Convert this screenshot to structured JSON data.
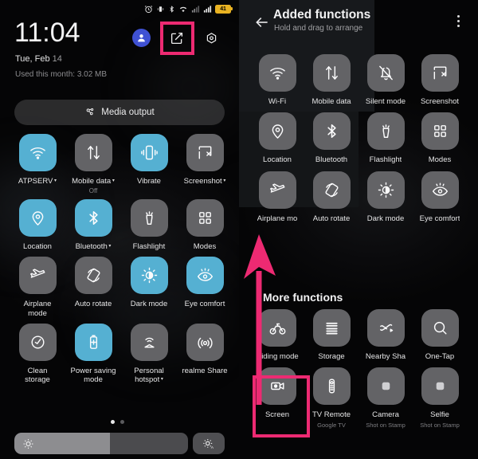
{
  "statusbar": {
    "icons": [
      "alarm-icon",
      "vibrate-icon",
      "bluetooth-icon",
      "wifi-icon",
      "signal-1-icon",
      "signal-2-icon"
    ],
    "battery_level": "41"
  },
  "shade": {
    "time": "11:04",
    "date_day": "Tue, Feb ",
    "date_num": "14",
    "data_usage": "Used this month: 3.02 MB",
    "media_output_label": "Media output",
    "avatar": "user-avatar",
    "edit_icon": "edit-icon",
    "settings_icon": "gear-icon",
    "page_dots": [
      "active",
      "inactive"
    ],
    "brightness_percent": 55,
    "auto_brightness_label": "auto-brightness"
  },
  "quick_tiles": [
    {
      "label": "ATPSERV",
      "caret": true,
      "sub": "",
      "on": true,
      "icon": "wifi-icon"
    },
    {
      "label": "Mobile data",
      "caret": true,
      "sub": "Off",
      "on": false,
      "icon": "mobile-data-icon"
    },
    {
      "label": "Vibrate",
      "caret": false,
      "sub": "",
      "on": true,
      "icon": "vibrate-icon"
    },
    {
      "label": "Screenshot",
      "caret": true,
      "sub": "",
      "on": false,
      "icon": "screenshot-icon"
    },
    {
      "label": "Location",
      "caret": false,
      "sub": "",
      "on": true,
      "icon": "location-icon"
    },
    {
      "label": "Bluetooth",
      "caret": true,
      "sub": "",
      "on": true,
      "icon": "bluetooth-icon"
    },
    {
      "label": "Flashlight",
      "caret": false,
      "sub": "",
      "on": false,
      "icon": "flashlight-icon"
    },
    {
      "label": "Modes",
      "caret": false,
      "sub": "",
      "on": false,
      "icon": "modes-icon"
    },
    {
      "label": "Airplane\nmode",
      "caret": false,
      "sub": "",
      "on": false,
      "icon": "airplane-icon"
    },
    {
      "label": "Auto rotate",
      "caret": false,
      "sub": "",
      "on": false,
      "icon": "auto-rotate-icon"
    },
    {
      "label": "Dark mode",
      "caret": false,
      "sub": "",
      "on": true,
      "icon": "dark-mode-icon"
    },
    {
      "label": "Eye comfort",
      "caret": false,
      "sub": "",
      "on": true,
      "icon": "eye-comfort-icon"
    },
    {
      "label": "Clean\nstorage",
      "caret": false,
      "sub": "",
      "on": false,
      "icon": "clean-storage-icon"
    },
    {
      "label": "Power saving\nmode",
      "caret": false,
      "sub": "",
      "on": true,
      "icon": "power-saving-icon"
    },
    {
      "label": "Personal\nhotspot",
      "caret": true,
      "sub": "",
      "on": false,
      "icon": "hotspot-icon"
    },
    {
      "label": "realme Share",
      "caret": false,
      "sub": "",
      "on": false,
      "icon": "realme-share-icon"
    }
  ],
  "added_functions": {
    "back_icon": "back-arrow-icon",
    "title": "Added functions",
    "subtitle": "Hold and drag to arrange",
    "overflow_icon": "overflow-menu-icon",
    "more_heading": "More functions",
    "page_dots_top": [
      "active",
      "inactive"
    ],
    "page_dots_bottom": [
      "inactive",
      "inactive",
      "active"
    ],
    "added_tiles": [
      {
        "label": "Wi-Fi",
        "sub": "",
        "icon": "wifi-icon"
      },
      {
        "label": "Mobile data",
        "sub": "",
        "icon": "mobile-data-icon"
      },
      {
        "label": "Silent mode",
        "sub": "",
        "icon": "silent-mode-icon"
      },
      {
        "label": "Screenshot",
        "sub": "",
        "icon": "screenshot-icon"
      },
      {
        "label": "Location",
        "sub": "",
        "icon": "location-icon"
      },
      {
        "label": "Bluetooth",
        "sub": "",
        "icon": "bluetooth-icon"
      },
      {
        "label": "Flashlight",
        "sub": "",
        "icon": "flashlight-icon"
      },
      {
        "label": "Modes",
        "sub": "",
        "icon": "modes-icon"
      },
      {
        "label": "Airplane mo",
        "sub": "",
        "icon": "airplane-icon"
      },
      {
        "label": "Auto rotate",
        "sub": "",
        "icon": "auto-rotate-icon"
      },
      {
        "label": "Dark mode",
        "sub": "",
        "icon": "dark-mode-icon"
      },
      {
        "label": "Eye comfort",
        "sub": "",
        "icon": "eye-comfort-icon"
      }
    ],
    "more_tiles": [
      {
        "label": "Riding mode",
        "sub": "",
        "icon": "riding-mode-icon"
      },
      {
        "label": "Storage",
        "sub": "",
        "icon": "storage-icon"
      },
      {
        "label": "Nearby Sha",
        "sub": "",
        "icon": "nearby-share-icon"
      },
      {
        "label": "One-Tap",
        "sub": "",
        "icon": "search-icon"
      },
      {
        "label": "Screen",
        "sub": "",
        "icon": "screen-recording-icon"
      },
      {
        "label": "TV Remote",
        "sub": "Google TV",
        "icon": "tv-remote-icon"
      },
      {
        "label": "Camera",
        "sub": "Shot on Stamp",
        "icon": "camera-icon"
      },
      {
        "label": "Selfie",
        "sub": "Shot on Stamp",
        "icon": "selfie-icon"
      }
    ]
  },
  "annotations": {
    "highlight_color": "#ed2a72",
    "boxes": [
      "edit-icon-highlight",
      "screen-recording-tile-highlight"
    ],
    "arrow": "drag-arrow-from-screen-recording-to-added-functions"
  },
  "colors": {
    "tile_on": "#55b0d2",
    "tile_off": "#636366",
    "accent_pink": "#ed2a72",
    "battery": "#e8b222",
    "avatar_blue": "#3f51d3"
  }
}
